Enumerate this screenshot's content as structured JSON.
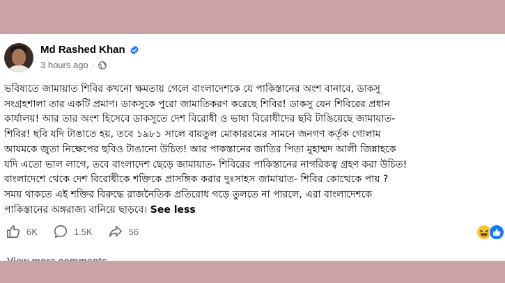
{
  "post": {
    "author": "Md Rashed Khan",
    "time": "3 hours ago",
    "separator": "·",
    "lines": [
      "ভবিষ্যতে জামায়াত শিবির কখনো ক্ষমতায় গেলে বাংলাদেশকে যে পাকিস্তানের অংশ বানাবে, ডাকসু",
      "সংগ্রহশালা তার একটি প্রমাণ। ডাকসুকে পুরো জামাতিকরণ করেছে শিবির! ডাকসু যেন শিবিরের প্রধান",
      "কার্যালয়! আর তার অংশ হিসেবে ডাকসুতে দেশ বিরোধী ও ভাষা বিরোধীদের ছবি টাঙিয়েছে জামায়াত-",
      "শিবির! ছবি যদি টাঙাতে হয়, তবে ১৯৮১ সালে বায়তুল মোকাররমের সামনে জনগণ কর্তৃক গোলাম",
      "আযমকে  জুতা নিক্ষেপের ছবিও টাঙানো উচিত! আর পাকস্তানের জাতির পিতা মুহাম্মদ আলী জিন্নাহকে",
      "যদি এতো ভাল লাগে, তবে বাংলাদেশ ছেড়ে জামায়াত- শিবিরের পাকিস্তানের নাগরিকত্ব গ্রহণ করা উচিত!",
      "বাংলাদেশে থেকে দেশ বিরোধীকে শক্তিকে প্রাসঙ্গিক করার দুঃসাহস জামায়াত- শিবির কোত্থেকে পায় ?",
      "সময় থাকতে এই শক্তির বিরুদ্ধে রাজনৈতিক প্রতিরোধ গড়ে তুলতে না পারলে, এরা বাংলাদেশকে"
    ],
    "last_line": "পাকিস্তানের অঙ্গরাজ্য বানিয়ে ছাড়বে।",
    "see_less": "See less"
  },
  "actions": {
    "likes": "6K",
    "comments": "1.5K",
    "shares": "56"
  },
  "comments_link": "View more comments",
  "colors": {
    "background": "#c9a3a5",
    "card": "#ffffff",
    "verified": "#1877f2",
    "muted": "#65676b"
  },
  "icons": [
    "verified-badge-icon",
    "globe-icon",
    "like-icon",
    "comment-icon",
    "share-icon",
    "haha-reaction-icon",
    "like-reaction-icon"
  ]
}
